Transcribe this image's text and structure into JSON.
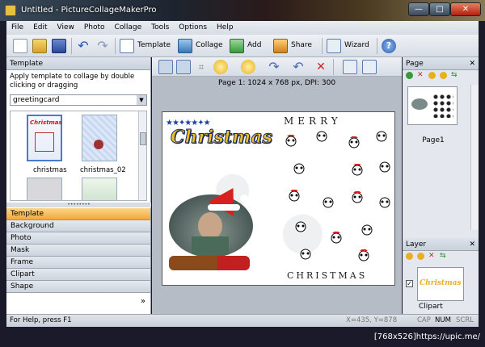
{
  "window": {
    "title": "Untitled - PictureCollageMakerPro",
    "minimize": "—",
    "maximize": "□",
    "close": "✕"
  },
  "menu": [
    "File",
    "Edit",
    "View",
    "Photo",
    "Collage",
    "Tools",
    "Options",
    "Help"
  ],
  "toolbar": {
    "template_label": "Template",
    "collage_label": "Collage",
    "add_label": "Add",
    "share_label": "Share",
    "wizard_label": "Wizard"
  },
  "template_panel": {
    "title": "Template",
    "hint": "Apply template to collage by double clicking or dragging",
    "category": "greetingcard",
    "thumbs": [
      {
        "label": "christmas",
        "selected": true
      },
      {
        "label": "christmas_02",
        "selected": false
      }
    ],
    "thumb_text": "Christmas",
    "categories": [
      {
        "label": "Template",
        "active": true
      },
      {
        "label": "Background",
        "active": false
      },
      {
        "label": "Photo",
        "active": false
      },
      {
        "label": "Mask",
        "active": false
      },
      {
        "label": "Frame",
        "active": false
      },
      {
        "label": "Clipart",
        "active": false
      },
      {
        "label": "Shape",
        "active": false
      }
    ],
    "more": "»"
  },
  "canvas_info": "Page 1: 1024 x 768 px, DPI: 300",
  "collage": {
    "header_text": "MERRY",
    "footer_text": "CHRISTMAS",
    "headline": "Christmas"
  },
  "page_panel": {
    "title": "Page",
    "page_label": "Page1"
  },
  "layer_panel": {
    "title": "Layer",
    "item_label": "Clipart",
    "item_text": "Christmas"
  },
  "status": {
    "help": "For Help, press F1",
    "coords": "X=435, Y=878",
    "cap": "CAP",
    "num": "NUM",
    "scrl": "SCRL"
  },
  "caption": "[768x526]https://upic.me/",
  "colors": {
    "accent_orange": "#f3a83a",
    "pane_blue": "#c8d0da"
  }
}
